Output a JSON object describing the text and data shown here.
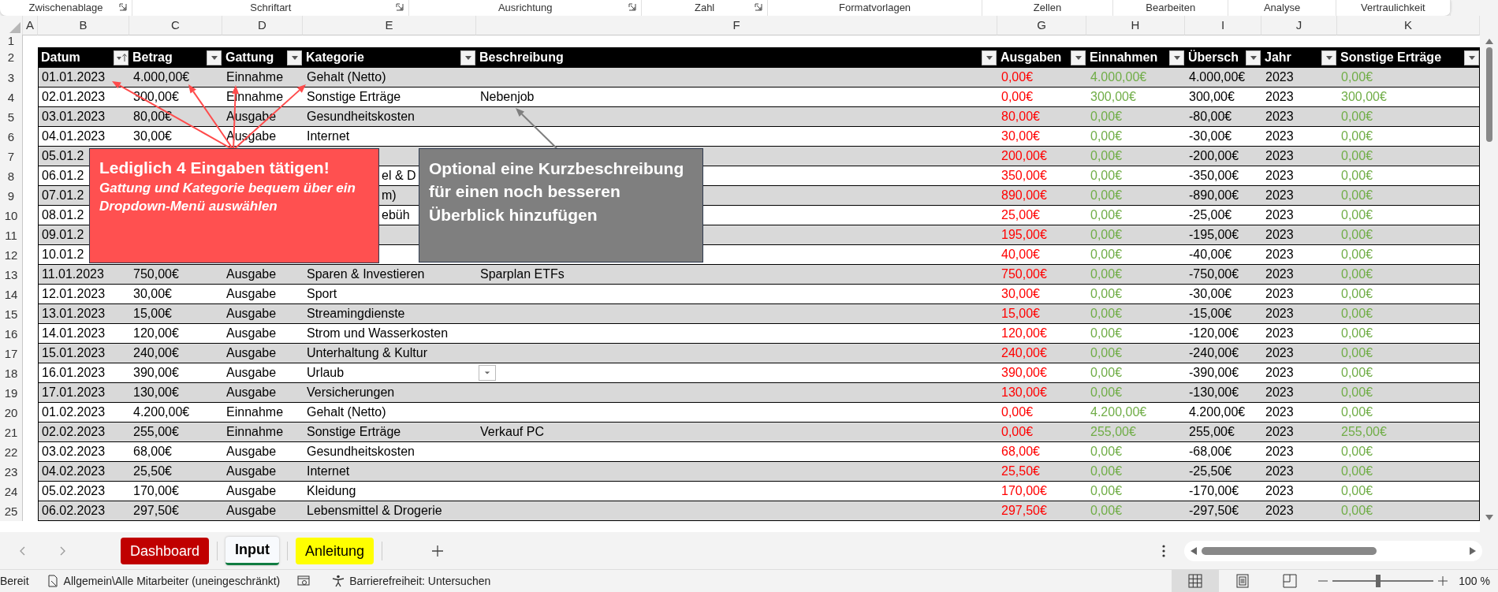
{
  "ribbon_groups": [
    {
      "label": "Zwischenablage",
      "launcher": true
    },
    {
      "label": "Schriftart",
      "launcher": true
    },
    {
      "label": "Ausrichtung",
      "launcher": true
    },
    {
      "label": "Zahl",
      "launcher": true
    },
    {
      "label": "Formatvorlagen",
      "launcher": false
    },
    {
      "label": "Zellen",
      "launcher": false
    },
    {
      "label": "Bearbeiten",
      "launcher": false
    },
    {
      "label": "Analyse",
      "launcher": false
    },
    {
      "label": "Vertraulichkeit",
      "launcher": false
    }
  ],
  "column_headers": [
    "A",
    "B",
    "C",
    "D",
    "E",
    "F",
    "G",
    "H",
    "I",
    "J",
    "K"
  ],
  "top_row_numbers": [
    "1",
    "2"
  ],
  "table": {
    "columns": [
      {
        "label": "Datum",
        "sorted": true
      },
      {
        "label": "Betrag",
        "sorted": false
      },
      {
        "label": "Gattung",
        "sorted": false
      },
      {
        "label": "Kategorie",
        "sorted": false
      },
      {
        "label": "Beschreibung",
        "sorted": false
      },
      {
        "label": "Ausgaben",
        "sorted": false
      },
      {
        "label": "Einnahmen",
        "sorted": false
      },
      {
        "label": "Übersch",
        "sorted": false
      },
      {
        "label": "Jahr",
        "sorted": false
      },
      {
        "label": "Sonstige Erträge",
        "sorted": false
      }
    ],
    "rows": [
      {
        "row": "3",
        "datum": "01.01.2023",
        "betrag": "4.000,00€",
        "gattung": "Einnahme",
        "kategorie": "Gehalt (Netto)",
        "ausgaben": "0,00€",
        "einnahmen": "4.000,00€",
        "ueberschuss": "4.000,00€",
        "jahr": "2023",
        "sonstige_ertraege": "0,00€"
      },
      {
        "row": "4",
        "datum": "02.01.2023",
        "betrag": "300,00€",
        "gattung": "Einnahme",
        "kategorie": "Sonstige Erträge",
        "beschreibung": "Nebenjob",
        "ausgaben": "0,00€",
        "einnahmen": "300,00€",
        "ueberschuss": "300,00€",
        "jahr": "2023",
        "sonstige_ertraege": "300,00€"
      },
      {
        "row": "5",
        "datum": "03.01.2023",
        "betrag": "80,00€",
        "gattung": "Ausgabe",
        "kategorie": "Gesundheitskosten",
        "ausgaben": "80,00€",
        "einnahmen": "0,00€",
        "ueberschuss": "-80,00€",
        "jahr": "2023",
        "sonstige_ertraege": "0,00€"
      },
      {
        "row": "6",
        "datum": "04.01.2023",
        "betrag": "30,00€",
        "gattung": "Ausgabe",
        "kategorie": "Internet",
        "ausgaben": "30,00€",
        "einnahmen": "0,00€",
        "ueberschuss": "-30,00€",
        "jahr": "2023",
        "sonstige_ertraege": "0,00€"
      },
      {
        "row": "7",
        "datum": "05.01.2",
        "ausgaben": "200,00€",
        "einnahmen": "0,00€",
        "ueberschuss": "-200,00€",
        "jahr": "2023",
        "sonstige_ertraege": "0,00€"
      },
      {
        "row": "8",
        "covered": true,
        "datum": "06.01.2",
        "kategorie": "el & D",
        "ausgaben": "350,00€",
        "einnahmen": "0,00€",
        "ueberschuss": "-350,00€",
        "jahr": "2023",
        "sonstige_ertraege": "0,00€"
      },
      {
        "row": "9",
        "covered": true,
        "datum": "07.01.2",
        "kategorie": "m)",
        "ausgaben": "890,00€",
        "einnahmen": "0,00€",
        "ueberschuss": "-890,00€",
        "jahr": "2023",
        "sonstige_ertraege": "0,00€"
      },
      {
        "row": "10",
        "covered": true,
        "datum": "08.01.2",
        "kategorie": "ebüh",
        "ausgaben": "25,00€",
        "einnahmen": "0,00€",
        "ueberschuss": "-25,00€",
        "jahr": "2023",
        "sonstige_ertraege": "0,00€"
      },
      {
        "row": "11",
        "datum": "09.01.2",
        "ausgaben": "195,00€",
        "einnahmen": "0,00€",
        "ueberschuss": "-195,00€",
        "jahr": "2023",
        "sonstige_ertraege": "0,00€"
      },
      {
        "row": "12",
        "datum": "10.01.2",
        "ausgaben": "40,00€",
        "einnahmen": "0,00€",
        "ueberschuss": "-40,00€",
        "jahr": "2023",
        "sonstige_ertraege": "0,00€"
      },
      {
        "row": "13",
        "datum": "11.01.2023",
        "betrag": "750,00€",
        "gattung": "Ausgabe",
        "kategorie": "Sparen & Investieren",
        "beschreibung": "Sparplan ETFs",
        "ausgaben": "750,00€",
        "einnahmen": "0,00€",
        "ueberschuss": "-750,00€",
        "jahr": "2023",
        "sonstige_ertraege": "0,00€"
      },
      {
        "row": "14",
        "datum": "12.01.2023",
        "betrag": "30,00€",
        "gattung": "Ausgabe",
        "kategorie": "Sport",
        "ausgaben": "30,00€",
        "einnahmen": "0,00€",
        "ueberschuss": "-30,00€",
        "jahr": "2023",
        "sonstige_ertraege": "0,00€"
      },
      {
        "row": "15",
        "datum": "13.01.2023",
        "betrag": "15,00€",
        "gattung": "Ausgabe",
        "kategorie": "Streamingdienste",
        "ausgaben": "15,00€",
        "einnahmen": "0,00€",
        "ueberschuss": "-15,00€",
        "jahr": "2023",
        "sonstige_ertraege": "0,00€"
      },
      {
        "row": "16",
        "datum": "14.01.2023",
        "betrag": "120,00€",
        "gattung": "Ausgabe",
        "kategorie": "Strom und Wasserkosten",
        "ausgaben": "120,00€",
        "einnahmen": "0,00€",
        "ueberschuss": "-120,00€",
        "jahr": "2023",
        "sonstige_ertraege": "0,00€"
      },
      {
        "row": "17",
        "datum": "15.01.2023",
        "betrag": "240,00€",
        "gattung": "Ausgabe",
        "kategorie": "Unterhaltung & Kultur",
        "ausgaben": "240,00€",
        "einnahmen": "0,00€",
        "ueberschuss": "-240,00€",
        "jahr": "2023",
        "sonstige_ertraege": "0,00€"
      },
      {
        "row": "18",
        "dropdown": true,
        "datum": "16.01.2023",
        "betrag": "390,00€",
        "gattung": "Ausgabe",
        "kategorie": "Urlaub",
        "ausgaben": "390,00€",
        "einnahmen": "0,00€",
        "ueberschuss": "-390,00€",
        "jahr": "2023",
        "sonstige_ertraege": "0,00€"
      },
      {
        "row": "19",
        "datum": "17.01.2023",
        "betrag": "130,00€",
        "gattung": "Ausgabe",
        "kategorie": "Versicherungen",
        "ausgaben": "130,00€",
        "einnahmen": "0,00€",
        "ueberschuss": "-130,00€",
        "jahr": "2023",
        "sonstige_ertraege": "0,00€"
      },
      {
        "row": "20",
        "datum": "01.02.2023",
        "betrag": "4.200,00€",
        "gattung": "Einnahme",
        "kategorie": "Gehalt (Netto)",
        "ausgaben": "0,00€",
        "einnahmen": "4.200,00€",
        "ueberschuss": "4.200,00€",
        "jahr": "2023",
        "sonstige_ertraege": "0,00€"
      },
      {
        "row": "21",
        "datum": "02.02.2023",
        "betrag": "255,00€",
        "gattung": "Einnahme",
        "kategorie": "Sonstige Erträge",
        "beschreibung": "Verkauf PC",
        "ausgaben": "0,00€",
        "einnahmen": "255,00€",
        "ueberschuss": "255,00€",
        "jahr": "2023",
        "sonstige_ertraege": "255,00€"
      },
      {
        "row": "22",
        "datum": "03.02.2023",
        "betrag": "68,00€",
        "gattung": "Ausgabe",
        "kategorie": "Gesundheitskosten",
        "ausgaben": "68,00€",
        "einnahmen": "0,00€",
        "ueberschuss": "-68,00€",
        "jahr": "2023",
        "sonstige_ertraege": "0,00€"
      },
      {
        "row": "23",
        "datum": "04.02.2023",
        "betrag": "25,50€",
        "gattung": "Ausgabe",
        "kategorie": "Internet",
        "ausgaben": "25,50€",
        "einnahmen": "0,00€",
        "ueberschuss": "-25,50€",
        "jahr": "2023",
        "sonstige_ertraege": "0,00€"
      },
      {
        "row": "24",
        "datum": "05.02.2023",
        "betrag": "170,00€",
        "gattung": "Ausgabe",
        "kategorie": "Kleidung",
        "ausgaben": "170,00€",
        "einnahmen": "0,00€",
        "ueberschuss": "-170,00€",
        "jahr": "2023",
        "sonstige_ertraege": "0,00€"
      },
      {
        "row": "25",
        "datum": "06.02.2023",
        "betrag": "297,50€",
        "gattung": "Ausgabe",
        "kategorie": "Lebensmittel & Drogerie",
        "ausgaben": "297,50€",
        "einnahmen": "0,00€",
        "ueberschuss": "-297,50€",
        "jahr": "2023",
        "sonstige_ertraege": "0,00€"
      }
    ]
  },
  "callouts": [
    {
      "kind": "red",
      "title": "Lediglich 4 Eingaben tätigen!",
      "text": "Gattung und Kategorie bequem über ein Dropdown-Menü auswählen"
    },
    {
      "kind": "gray",
      "title": "Optional eine Kurzbeschreibung für einen noch besseren Überblick hinzufügen"
    }
  ],
  "sheet_tabs": [
    {
      "label": "Dashboard",
      "selected": false,
      "color": "#c00000"
    },
    {
      "label": "Input",
      "selected": true
    },
    {
      "label": "Anleitung",
      "selected": false,
      "color": "#ffff00"
    }
  ],
  "status_bar": {
    "ready": "Bereit",
    "sensitivity": "Allgemein\\Alle Mitarbeiter (uneingeschränkt)",
    "accessibility": "Barrierefreiheit: Untersuchen",
    "views": [
      {
        "kind": "normal",
        "selected": true
      },
      {
        "kind": "page_layout",
        "selected": false
      },
      {
        "kind": "page_break",
        "selected": false
      }
    ],
    "zoom": {
      "level": 0.45,
      "reading": "100 %"
    }
  }
}
